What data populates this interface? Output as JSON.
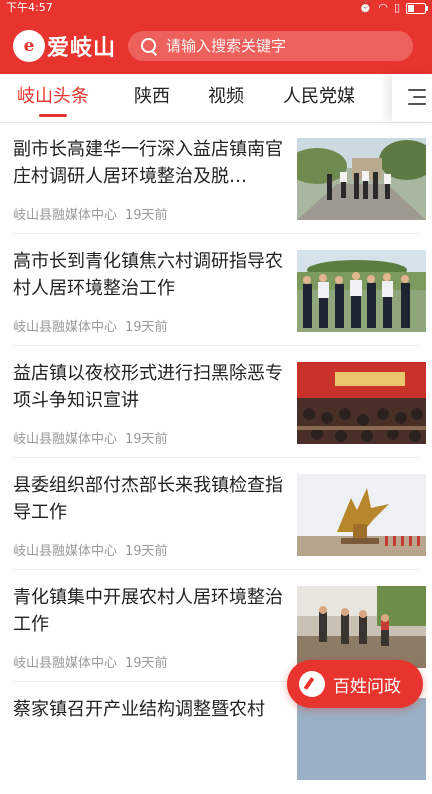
{
  "status_bar": {
    "time": "下午4:57",
    "icons": [
      "alarm-off-icon",
      "wifi-icon",
      "sim-icon",
      "battery-icon"
    ],
    "battery_level": 0.35
  },
  "header": {
    "logo_mark": "e",
    "logo_text": "爱岐山",
    "search_placeholder": "请输入搜索关键字"
  },
  "tabs": [
    {
      "label": "岐山头条",
      "active": true
    },
    {
      "label": "陕西",
      "active": false
    },
    {
      "label": "视频",
      "active": false
    },
    {
      "label": "人民党媒",
      "active": false
    }
  ],
  "news": [
    {
      "title": "副市长高建华一行深入益店镇南官庄村调研人居环境整治及脱…",
      "source": "岐山县融媒体中心",
      "time": "19天前",
      "thumb": "officials-walking-road"
    },
    {
      "title": "高市长到青化镇焦六村调研指导农村人居环境整治工作",
      "source": "岐山县融媒体中心",
      "time": "19天前",
      "thumb": "officials-standing-group"
    },
    {
      "title": "益店镇以夜校形式进行扫黑除恶专项斗争知识宣讲",
      "source": "岐山县融媒体中心",
      "time": "19天前",
      "thumb": "meeting-hall"
    },
    {
      "title": "县委组织部付杰部长来我镇检查指导工作",
      "source": "岐山县融媒体中心",
      "time": "19天前",
      "thumb": "phoenix-statue"
    },
    {
      "title": "青化镇集中开展农村人居环境整治工作",
      "source": "岐山县融媒体中心",
      "time": "19天前",
      "thumb": "villagers-cleaning"
    },
    {
      "title": "蔡家镇召开产业结构调整暨农村",
      "source": "",
      "time": "",
      "thumb": "partial"
    }
  ],
  "fab": {
    "label": "百姓问政",
    "icon": "edit-icon"
  },
  "colors": {
    "brand_red": "#e8342e",
    "meta_gray": "#999999"
  }
}
